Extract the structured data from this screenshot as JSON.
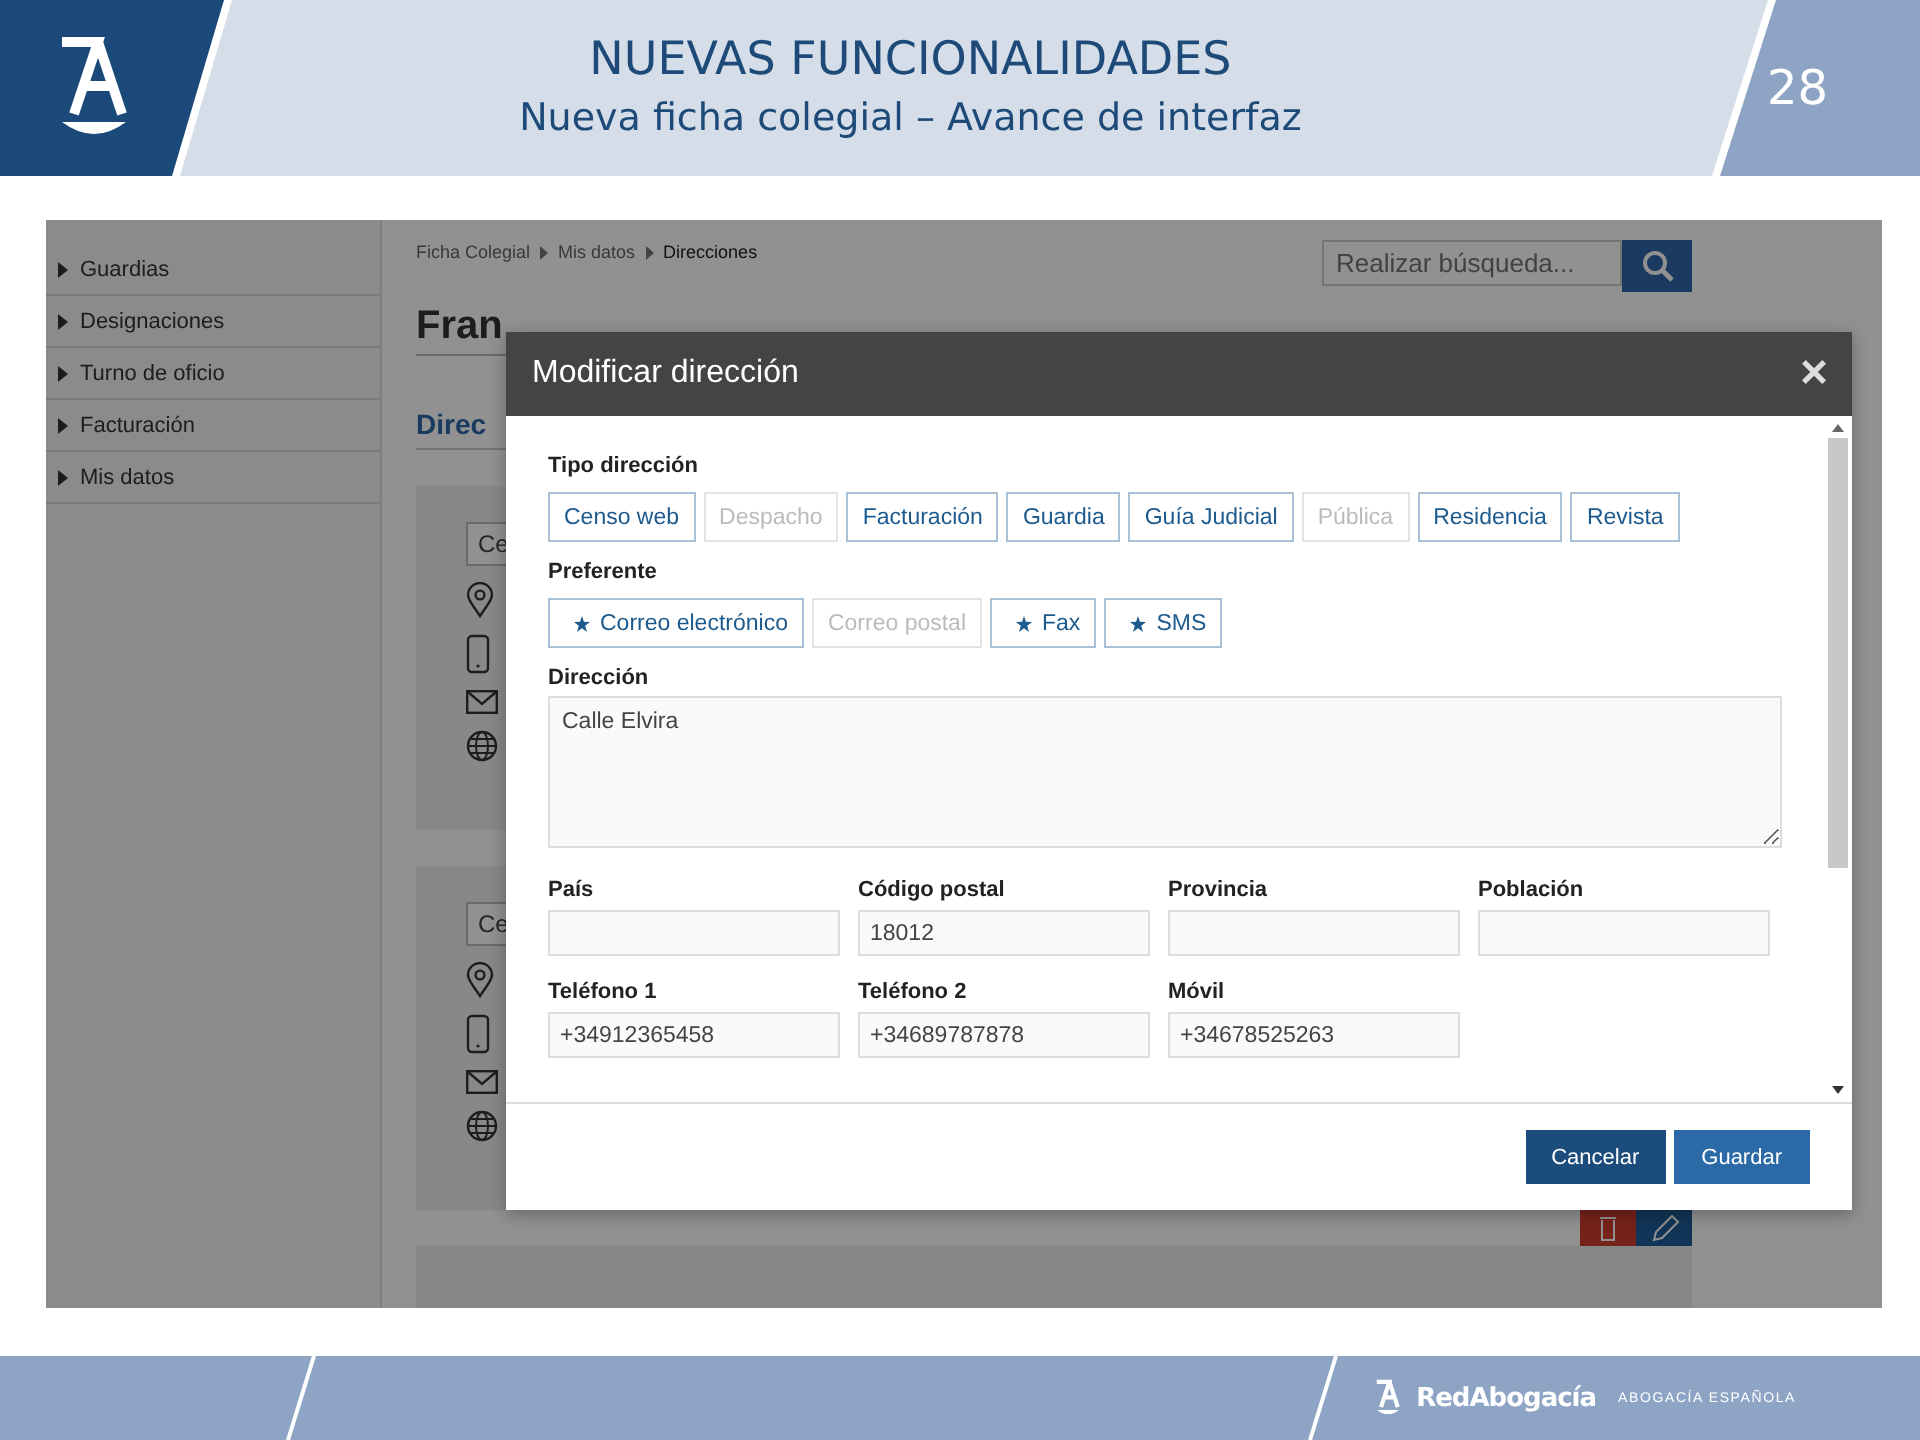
{
  "slide": {
    "title": "NUEVAS FUNCIONALIDADES",
    "subtitle": "Nueva ficha colegial – Avance de interfaz",
    "page": "28"
  },
  "sidebar": {
    "items": [
      {
        "label": "Guardias"
      },
      {
        "label": "Designaciones"
      },
      {
        "label": "Turno de oficio"
      },
      {
        "label": "Facturación"
      },
      {
        "label": "Mis datos"
      }
    ]
  },
  "breadcrumb": [
    "Ficha Colegial",
    "Mis datos",
    "Direcciones"
  ],
  "search": {
    "placeholder": "Realizar búsqueda..."
  },
  "heading": "Fran",
  "section": "Direc",
  "cards": [
    {
      "button": "Ce"
    },
    {
      "button": "Ce"
    }
  ],
  "dialog": {
    "title": "Modificar dirección",
    "close": "×",
    "tipo_label": "Tipo dirección",
    "tipo_options": [
      {
        "label": "Censo web",
        "selected": true
      },
      {
        "label": "Despacho",
        "selected": false
      },
      {
        "label": "Facturación",
        "selected": true
      },
      {
        "label": "Guardia",
        "selected": true
      },
      {
        "label": "Guía Judicial",
        "selected": true
      },
      {
        "label": "Pública",
        "selected": false
      },
      {
        "label": "Residencia",
        "selected": true
      },
      {
        "label": "Revista",
        "selected": true
      }
    ],
    "preferente_label": "Preferente",
    "preferente_options": [
      {
        "label": "Correo electrónico",
        "selected": true
      },
      {
        "label": "Correo postal",
        "selected": false
      },
      {
        "label": "Fax",
        "selected": true
      },
      {
        "label": "SMS",
        "selected": true
      }
    ],
    "direccion": {
      "label": "Dirección",
      "value": "Calle Elvira"
    },
    "fields": [
      {
        "label": "País"
      },
      {
        "label": "Código postal",
        "value": "18012"
      },
      {
        "label": "Provincia"
      },
      {
        "label": "Población"
      },
      {
        "label": "Teléfono 1",
        "value": "+34912365458"
      },
      {
        "label": "Teléfono 2",
        "value": "+34689787878"
      },
      {
        "label": "Móvil",
        "value": "+34678525263"
      }
    ],
    "buttons": [
      {
        "label": "Cancelar",
        "kind": "secondary"
      },
      {
        "label": "Guardar",
        "kind": "primary"
      }
    ]
  },
  "footer": {
    "brand": "RedAbogacía",
    "tagline": "ABOGACÍA ESPAÑOLA"
  }
}
